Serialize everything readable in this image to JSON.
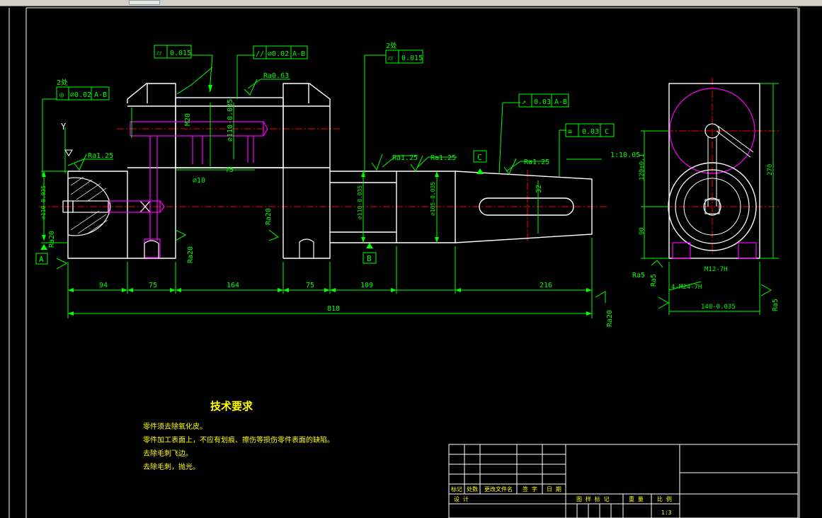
{
  "colors": {
    "background": "#000000",
    "outline": "#ffffff",
    "dimension": "#00ff00",
    "centerline": "#ff0000",
    "hidden": "#ff00ff",
    "notes": "#ffff00"
  },
  "gdt": {
    "fcf_top_left": {
      "symbol": "⌭",
      "value": "0.015"
    },
    "fcf_top_mid": {
      "symbol": "//",
      "value": "⌀0.02",
      "datum": "A-B"
    },
    "fcf_left": {
      "note": "2处",
      "symbol": "◎",
      "value": "⌀0.02",
      "datum": "A-B"
    },
    "fcf_top_right": {
      "note": "2处",
      "symbol": "⌭",
      "value": "0.015"
    },
    "fcf_runout": {
      "symbol": "↗",
      "value": "0.03",
      "datum": "A-B"
    },
    "fcf_symmetry": {
      "symbol": "≡",
      "value": "0.03",
      "datum": "C"
    },
    "taper": "1:10.05"
  },
  "roughness": {
    "ra063": "Ra0.63",
    "ra125": "Ra1.25",
    "ra20": "Ra20",
    "ra5": "Ra5"
  },
  "labels": {
    "m20": "M20",
    "hole_10": "⌀10",
    "dia_top": "⌀110-0.035",
    "dia_left": "⌀110-0.035",
    "dia_mid": "⌀110-0.035",
    "dia_taper": "⌀105-0.035",
    "slot": "32",
    "axis_y": "Y",
    "m12": "M12-7H",
    "m24": "4-M24-7H",
    "side_h1": "120±0.1",
    "side_h2": "90",
    "side_h3": "270",
    "side_w": "140-0.035"
  },
  "datums": {
    "a": "A",
    "b": "B",
    "c": "C"
  },
  "dimensions": {
    "seg1": "94",
    "seg2": "75",
    "seg3": "164",
    "seg4": "75",
    "seg5": "109",
    "seg6": "216",
    "total": "818",
    "inner75": "75"
  },
  "notes": {
    "title": "技术要求",
    "items": [
      "零件须去除氧化皮。",
      "零件加工表面上，不应有划痕、擦伤等损伤零件表面的缺陷。",
      "去除毛刺飞边。",
      "去除毛刺，抛光。"
    ]
  },
  "title_block": {
    "row_labels": [
      "标记",
      "处数",
      "更改文件名",
      "签 字",
      "日 期"
    ],
    "design": "设 计",
    "stage": "图 样 标 记",
    "weight": "重 量",
    "scale_label": "比 例",
    "scale": "1:3"
  }
}
